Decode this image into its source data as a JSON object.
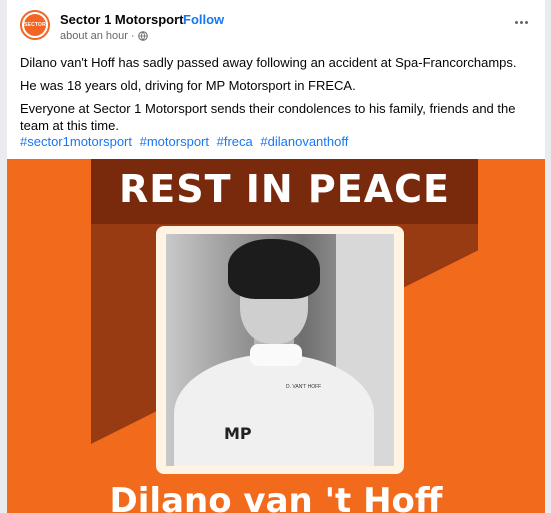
{
  "post": {
    "page_name": "Sector 1 Motorsport",
    "separator": "·",
    "follow_label": "Follow",
    "timestamp": "about an hour",
    "timestamp_sep": "·",
    "avatar_text": "SECTOR",
    "paragraphs": [
      "Dilano van't Hoff has sadly passed away following an accident at Spa-Francorchamps.",
      "He was 18 years old, driving for MP Motorsport in FRECA.",
      "Everyone at Sector 1 Motorsport sends their condolences to his family, friends and the team at this time."
    ],
    "hashtags": [
      "#sector1motorsport",
      "#motorsport",
      "#freca",
      "#dilanovanthoff"
    ]
  },
  "image": {
    "headline": "REST IN PEACE",
    "name": "Dilano van 't Hoff",
    "suit_logo": "MP",
    "suit_text": "D. VAN'T HOFF"
  },
  "colors": {
    "accent": "#1877f2",
    "orange": "#f26b1d",
    "banner": "#7a2a0c"
  }
}
